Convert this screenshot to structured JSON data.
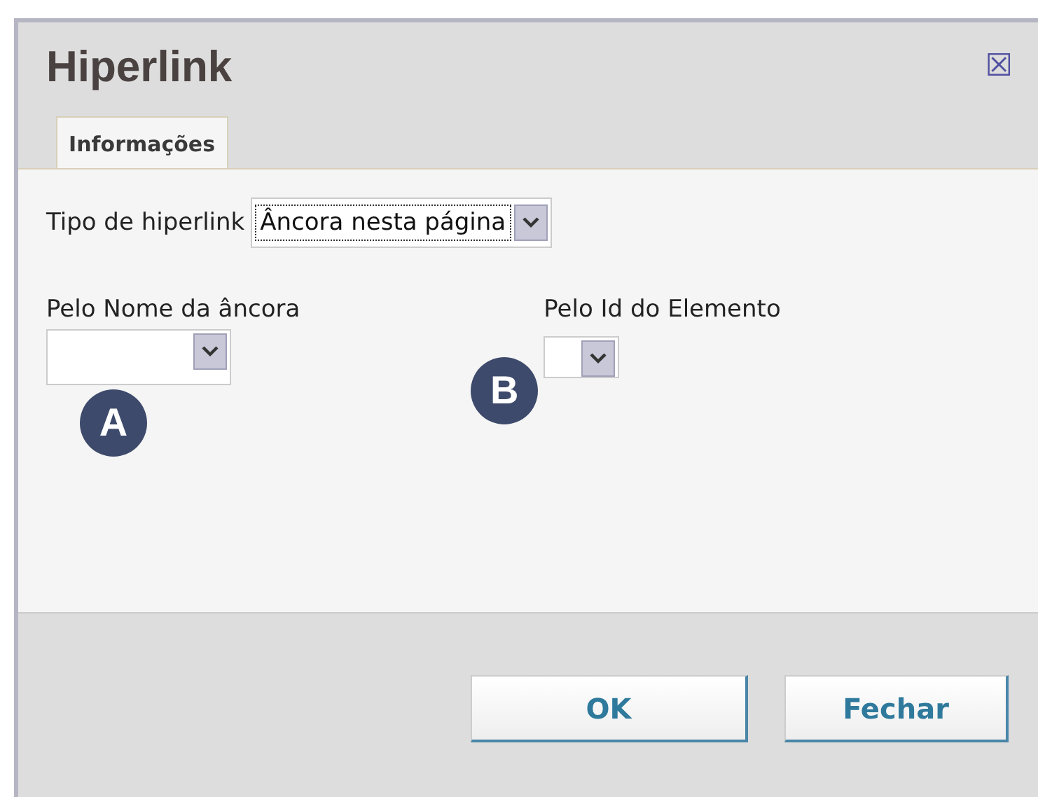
{
  "dialog": {
    "title": "Hiperlink",
    "close": "☒"
  },
  "tabs": [
    {
      "label": "Informações",
      "selected": true
    }
  ],
  "link_type": {
    "label": "Tipo de hiperlink",
    "value": "Âncora nesta página"
  },
  "fields": [
    {
      "label": "Pelo Nome da âncora",
      "badge": "A",
      "kind": "wide"
    },
    {
      "label": "Pelo Id do Elemento",
      "badge": "B",
      "kind": "narrow"
    }
  ],
  "buttons": [
    "OK",
    "Fechar"
  ]
}
